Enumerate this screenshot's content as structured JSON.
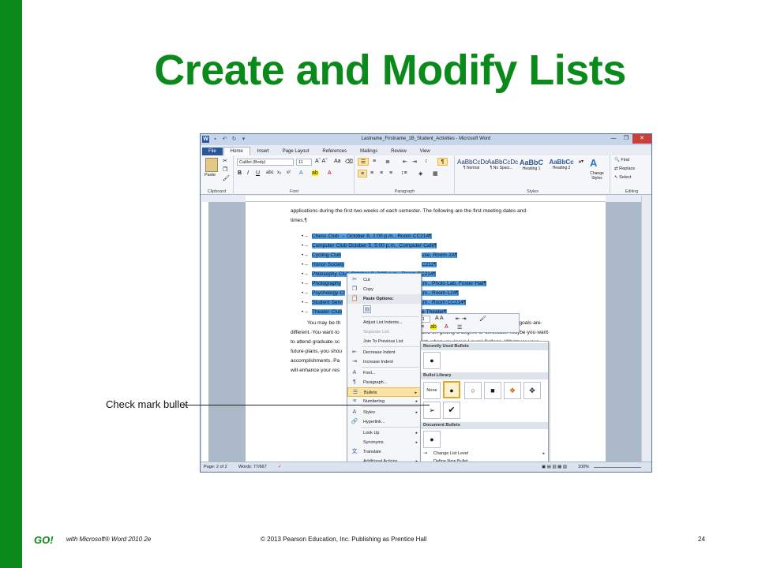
{
  "slide": {
    "title": "Create and Modify Lists",
    "callout": "Check mark bullet",
    "footer": {
      "logo": "GO!",
      "product": "with Microsoft® Word 2010 2e",
      "copyright": "© 2013 Pearson Education, Inc. Publishing as Prentice Hall",
      "page": "24"
    }
  },
  "word": {
    "title": "Lastname_Firstname_1B_Student_Activities - Microsoft Word",
    "tabs": [
      "File",
      "Home",
      "Insert",
      "Page Layout",
      "References",
      "Mailings",
      "Review",
      "View"
    ],
    "active_tab": "Home",
    "ribbon": {
      "clipboard_label": "Clipboard",
      "paste_label": "Paste",
      "font_label": "Font",
      "font_name": "Calibri (Body)",
      "font_size": "11",
      "paragraph_label": "Paragraph",
      "styles_label": "Styles",
      "editing_label": "Editing",
      "styles": [
        {
          "sample": "AaBbCcDc",
          "name": "¶ Normal"
        },
        {
          "sample": "AaBbCcDc",
          "name": "¶ No Spaci..."
        },
        {
          "sample": "AaBbC",
          "name": "Heading 1"
        },
        {
          "sample": "AaBbCc",
          "name": "Heading 2"
        }
      ],
      "change_styles": "Change Styles",
      "find": "Find",
      "replace": "Replace",
      "select": "Select"
    },
    "document": {
      "intro_line1": "applications·during·the·first·two·weeks·of·each·semester.·The·following·are·the·first·meeting·dates·and·",
      "intro_line2": "times.¶",
      "list": [
        {
          "left": "Chess·Club → October·8,·2:00·p.m.,·Room·CC214¶",
          "right": ""
        },
        {
          "left": "Computer·Club·October·5,·5:00·p.m.,·Computer·Café¶",
          "right": ""
        },
        {
          "left": "Cycling·Club",
          "right": "use,·Room·2A¶"
        },
        {
          "left": "Honor·Society",
          "right": "C212¶"
        },
        {
          "left": "Philosophy·Club·October·8,·3:00·p.m.,·Room·CC214¶",
          "right": ""
        },
        {
          "left": "Photography",
          "right": ".m.,·Photo·Lab,·Foster·Hall¶"
        },
        {
          "left": "Psychology·Cl",
          "right": ".m.,·Room·L24¶"
        },
        {
          "left": "Student·Servi",
          "right": ".m.,·Room·CC214¶"
        },
        {
          "left": "Theater·Club",
          "right": "e·Theater¶"
        }
      ],
      "body_lines": [
        {
          "left": "You·may·be·th",
          "right": "s·the·ones·listed·here,·are·great,·but·your·goals·are·"
        },
        {
          "left": "different.·You·want·to",
          "right": "and·on·getting·a·degree·or·certificate.·Maybe·you·want·"
        },
        {
          "left": "to·attend·graduate·sc",
          "right": "job·when·you·leave·Laurel·College.·Whatever·your·"
        },
        {
          "left": "future·plans,·you·shou",
          "right": ""
        },
        {
          "left": "accomplishments.·Pa",
          "right": ""
        },
        {
          "left": "will·enhance·your·res",
          "right": "role,·"
        }
      ]
    },
    "mini_toolbar": {
      "font": "Calibri (E",
      "size": "11"
    },
    "context_menu": [
      {
        "label": "Cut",
        "icon": "scissors-icon",
        "glyph": "✂",
        "state": "normal"
      },
      {
        "label": "Copy",
        "icon": "copy-icon",
        "glyph": "❐",
        "state": "normal"
      },
      {
        "label": "Paste Options:",
        "icon": "paste-icon",
        "glyph": "📋",
        "state": "header"
      },
      {
        "label": "",
        "icon": "paste-keep-text-icon",
        "glyph": "▤",
        "state": "pasteicon"
      },
      {
        "label": "Adjust List Indents...",
        "icon": "",
        "glyph": "",
        "state": "normal"
      },
      {
        "label": "Separate List",
        "icon": "",
        "glyph": "",
        "state": "disabled"
      },
      {
        "label": "Join To Previous List",
        "icon": "",
        "glyph": "",
        "state": "normal"
      },
      {
        "label": "Decrease Indent",
        "icon": "decrease-indent-icon",
        "glyph": "⇤",
        "state": "normal"
      },
      {
        "label": "Increase Indent",
        "icon": "increase-indent-icon",
        "glyph": "⇥",
        "state": "normal"
      },
      {
        "label": "Font...",
        "icon": "font-icon",
        "glyph": "A",
        "state": "normal"
      },
      {
        "label": "Paragraph...",
        "icon": "paragraph-icon",
        "glyph": "¶",
        "state": "normal"
      },
      {
        "label": "Bullets",
        "icon": "bullets-icon",
        "glyph": "☰",
        "state": "highlight",
        "submenu": true
      },
      {
        "label": "Numbering",
        "icon": "numbering-icon",
        "glyph": "≡",
        "state": "normal",
        "submenu": true
      },
      {
        "label": "Styles",
        "icon": "styles-icon",
        "glyph": "A",
        "state": "normal",
        "submenu": true
      },
      {
        "label": "Hyperlink...",
        "icon": "hyperlink-icon",
        "glyph": "🔗",
        "state": "normal"
      },
      {
        "label": "Look Up",
        "icon": "",
        "glyph": "",
        "state": "normal",
        "submenu": true
      },
      {
        "label": "Synonyms",
        "icon": "",
        "glyph": "",
        "state": "normal",
        "submenu": true
      },
      {
        "label": "Translate",
        "icon": "translate-icon",
        "glyph": "文",
        "state": "normal"
      },
      {
        "label": "Additional Actions",
        "icon": "",
        "glyph": "",
        "state": "normal",
        "submenu": true
      }
    ],
    "bullet_gallery": {
      "recent_header": "Recently Used Bullets",
      "library_header": "Bullet Library",
      "document_header": "Document Bullets",
      "none_label": "None",
      "library": [
        "None",
        "●",
        "○",
        "■",
        "❖",
        "✥",
        "➢",
        "✔"
      ],
      "change_level": "Change List Level",
      "define_new": "Define New Bullet..."
    },
    "status": {
      "page": "Page: 2 of 2",
      "words": "Words: 77/667",
      "zoom": "100%"
    }
  }
}
